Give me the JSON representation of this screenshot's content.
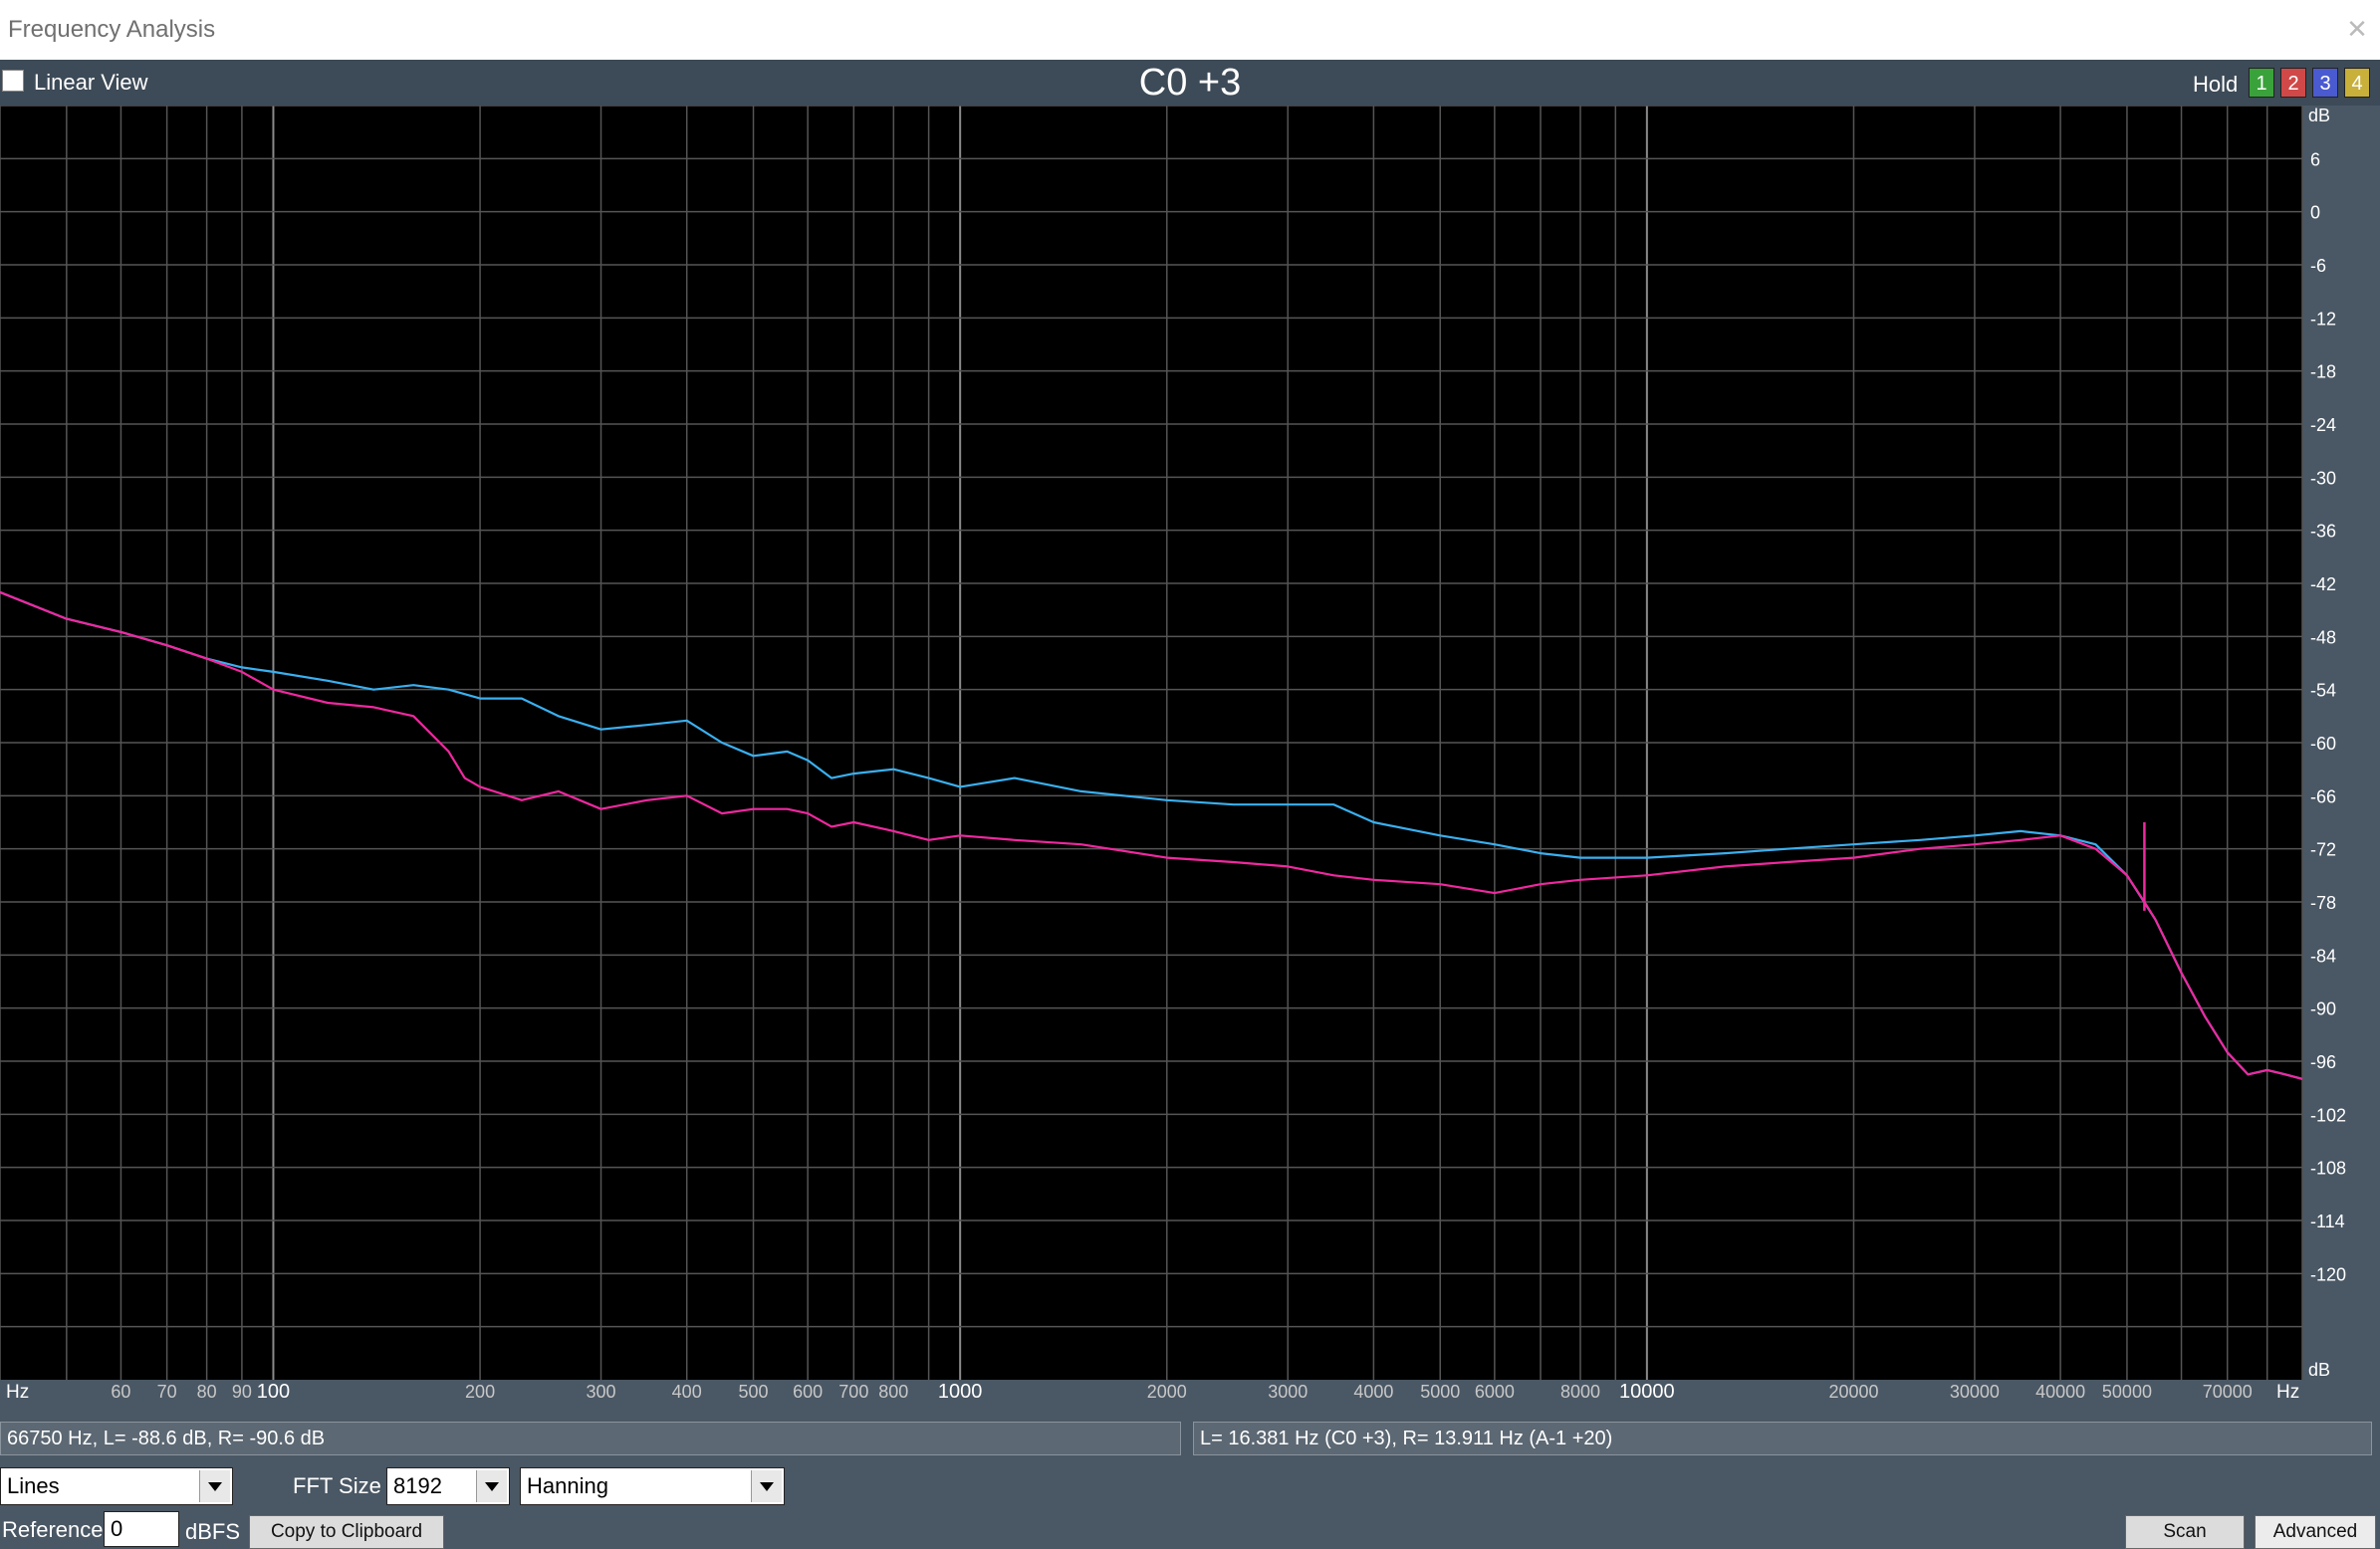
{
  "window": {
    "title": "Frequency Analysis",
    "close_glyph": "✕"
  },
  "toolbar": {
    "linear_view_label": "Linear View",
    "note": "C0 +3",
    "hold_label": "Hold",
    "hold_buttons": [
      "1",
      "2",
      "3",
      "4"
    ],
    "hold_colors": [
      "#3aa23a",
      "#d04848",
      "#4a5ad0",
      "#c8b03a"
    ]
  },
  "chart_data": {
    "type": "line",
    "x_scale": "log",
    "xlim": [
      40,
      90000
    ],
    "ylim": [
      -132,
      12
    ],
    "grid": true,
    "x_tick_labels": [
      {
        "f": 60,
        "label": "60"
      },
      {
        "f": 70,
        "label": "70"
      },
      {
        "f": 80,
        "label": "80"
      },
      {
        "f": 90,
        "label": "90"
      },
      {
        "f": 100,
        "label": "100"
      },
      {
        "f": 200,
        "label": "200"
      },
      {
        "f": 300,
        "label": "300"
      },
      {
        "f": 400,
        "label": "400"
      },
      {
        "f": 500,
        "label": "500"
      },
      {
        "f": 600,
        "label": "600"
      },
      {
        "f": 700,
        "label": "700"
      },
      {
        "f": 800,
        "label": "800"
      },
      {
        "f": 1000,
        "label": "1000"
      },
      {
        "f": 2000,
        "label": "2000"
      },
      {
        "f": 3000,
        "label": "3000"
      },
      {
        "f": 4000,
        "label": "4000"
      },
      {
        "f": 5000,
        "label": "5000"
      },
      {
        "f": 6000,
        "label": "6000"
      },
      {
        "f": 8000,
        "label": "8000"
      },
      {
        "f": 10000,
        "label": "10000"
      },
      {
        "f": 20000,
        "label": "20000"
      },
      {
        "f": 30000,
        "label": "30000"
      },
      {
        "f": 40000,
        "label": "40000"
      },
      {
        "f": 50000,
        "label": "50000"
      },
      {
        "f": 70000,
        "label": "70000"
      }
    ],
    "x_unit_left": "Hz",
    "x_unit_right": "Hz",
    "y_ticks": [
      6,
      0,
      -6,
      -12,
      -18,
      -24,
      -30,
      -36,
      -42,
      -48,
      -54,
      -60,
      -66,
      -72,
      -78,
      -84,
      -90,
      -96,
      -102,
      -108,
      -114,
      -120
    ],
    "y_unit_top": "dB",
    "y_unit_bottom": "dB",
    "series": [
      {
        "color": "#3ab0f0",
        "x": [
          40,
          50,
          60,
          70,
          80,
          90,
          100,
          120,
          140,
          160,
          180,
          200,
          230,
          260,
          300,
          350,
          400,
          450,
          500,
          560,
          600,
          650,
          700,
          800,
          900,
          1000,
          1200,
          1500,
          2000,
          2500,
          3000,
          3500,
          4000,
          5000,
          6000,
          7000,
          8000,
          10000,
          13000,
          16000,
          20000,
          25000,
          30000,
          35000,
          40000,
          45000,
          50000,
          55000,
          60000,
          65000,
          70000,
          75000,
          80000,
          85000,
          90000
        ],
        "y": [
          -43,
          -46,
          -47.5,
          -49,
          -50.5,
          -51.5,
          -52,
          -53,
          -54,
          -53.5,
          -54,
          -55,
          -55,
          -57,
          -58.5,
          -58,
          -57.5,
          -60,
          -61.5,
          -61,
          -62,
          -64,
          -63.5,
          -63,
          -64,
          -65,
          -64,
          -65.5,
          -66.5,
          -67,
          -67,
          -67,
          -69,
          -70.5,
          -71.5,
          -72.5,
          -73,
          -73,
          -72.5,
          -72,
          -71.5,
          -71,
          -70.5,
          -70,
          -70.5,
          -71.5,
          -75,
          -80,
          -86,
          -91,
          -95,
          -97.5,
          -97,
          -97.5,
          -98
        ]
      },
      {
        "color": "#f028a0",
        "x": [
          40,
          50,
          60,
          70,
          80,
          90,
          100,
          120,
          140,
          160,
          180,
          190,
          200,
          230,
          260,
          300,
          350,
          400,
          450,
          500,
          560,
          600,
          650,
          700,
          800,
          900,
          1000,
          1200,
          1500,
          2000,
          2500,
          3000,
          3500,
          4000,
          5000,
          6000,
          7000,
          8000,
          10000,
          13000,
          16000,
          20000,
          25000,
          30000,
          35000,
          40000,
          45000,
          50000,
          53000,
          55000,
          60000,
          65000,
          70000,
          75000,
          80000,
          85000,
          90000
        ],
        "y": [
          -43,
          -46,
          -47.5,
          -49,
          -50.5,
          -52,
          -54,
          -55.5,
          -56,
          -57,
          -61,
          -64,
          -65,
          -66.5,
          -65.5,
          -67.5,
          -66.5,
          -66,
          -68,
          -67.5,
          -67.5,
          -68,
          -69.5,
          -69,
          -70,
          -71,
          -70.5,
          -71,
          -71.5,
          -73,
          -73.5,
          -74,
          -75,
          -75.5,
          -76,
          -77,
          -76,
          -75.5,
          -75,
          -74,
          -73.5,
          -73,
          -72,
          -71.5,
          -71,
          -70.5,
          -72,
          -75,
          -78,
          -80,
          -86,
          -91,
          -95,
          -97.5,
          -97,
          -97.5,
          -98
        ]
      }
    ],
    "spike": {
      "color": "#f028a0",
      "f": 53000,
      "y_top": -69,
      "y_base": -79
    }
  },
  "status": {
    "cursor_readout": "66750 Hz, L= -88.6 dB, R= -90.6 dB",
    "peak_readout": "L= 16.381 Hz (C0 +3), R= 13.911 Hz (A-1 +20)"
  },
  "controls": {
    "display_mode": "Lines",
    "fft_size_label": "FFT Size",
    "fft_size": "8192",
    "window_function": "Hanning",
    "reference_label": "Reference",
    "reference_value": "0",
    "reference_unit": "dBFS",
    "copy_label": "Copy to Clipboard",
    "scan_label": "Scan",
    "advanced_label": "Advanced"
  }
}
